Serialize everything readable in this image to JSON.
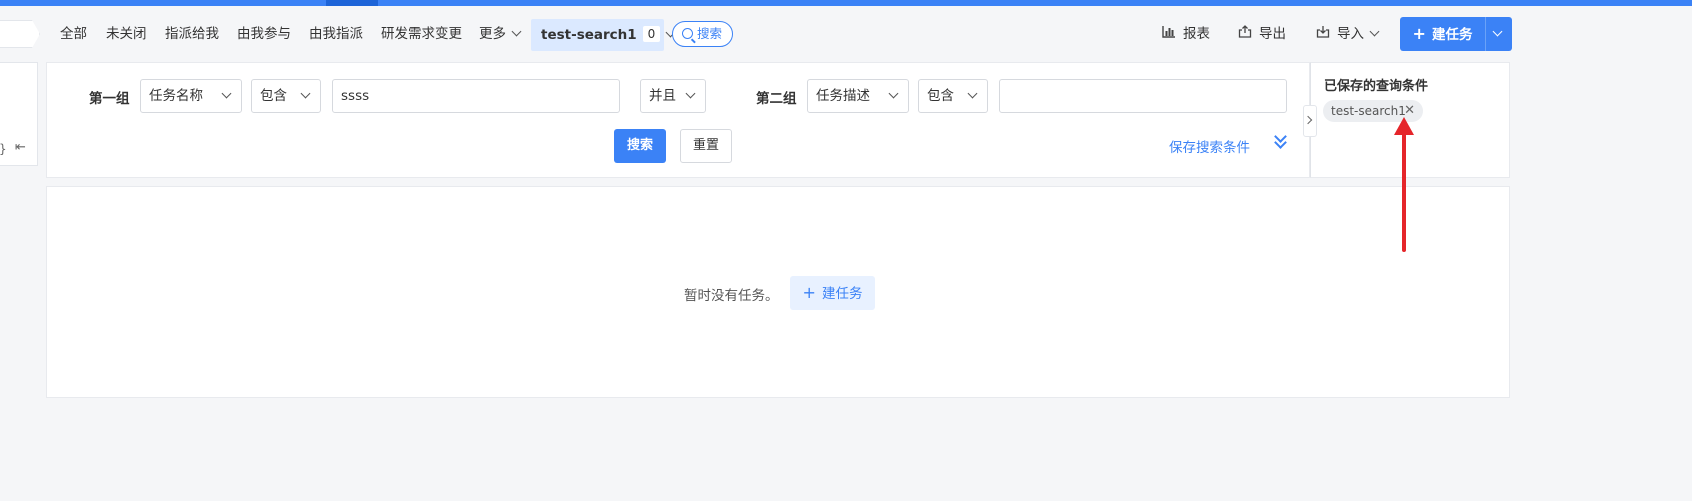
{
  "nav": {
    "tabs": [
      "全部",
      "未关闭",
      "指派给我",
      "由我参与",
      "由我指派",
      "研发需求变更"
    ],
    "more_label": "更多",
    "active_tab": {
      "label": "test-search1",
      "count": "0"
    },
    "search_label": "搜索",
    "tools": {
      "report": "报表",
      "export": "导出",
      "import": "导入"
    },
    "new_task_label": "建任务"
  },
  "left_stub": {
    "glyph_a": "}",
    "glyph_b": "⇤"
  },
  "filter": {
    "group1": {
      "label": "第一组",
      "field": "任务名称",
      "operator": "包含",
      "value": "ssss"
    },
    "logic": "并且",
    "group2": {
      "label": "第二组",
      "field": "任务描述",
      "operator": "包含",
      "value": ""
    },
    "search_btn": "搜索",
    "reset_btn": "重置",
    "save_link": "保存搜索条件"
  },
  "saved_panel": {
    "title": "已保存的查询条件",
    "items": [
      {
        "label": "test-search1",
        "remove": "✕"
      }
    ]
  },
  "content": {
    "empty_text": "暂时没有任务。",
    "new_task_label": "建任务"
  },
  "colors": {
    "accent": "#3b82f6",
    "annotation": "#e5252a",
    "active_tab_bg": "#dbe9ff"
  }
}
